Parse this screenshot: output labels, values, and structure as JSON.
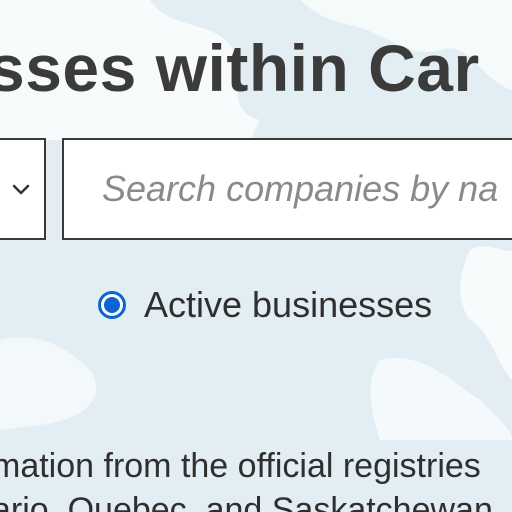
{
  "header": {
    "title": "sses within Car"
  },
  "filter": {
    "dropdown_icon": "chevron-down-icon"
  },
  "search": {
    "placeholder": "Search companies by na",
    "value": ""
  },
  "status_filter": {
    "option_label": "Active businesses",
    "selected": true
  },
  "description": {
    "line1": "mation from the official registries",
    "line2": "ario, Quebec, and Saskatchewan"
  },
  "colors": {
    "background": "#e2eef3",
    "map_land": "#f7fbfc",
    "radio_accent": "#0a64d2",
    "title_text": "#3b3b3b"
  }
}
